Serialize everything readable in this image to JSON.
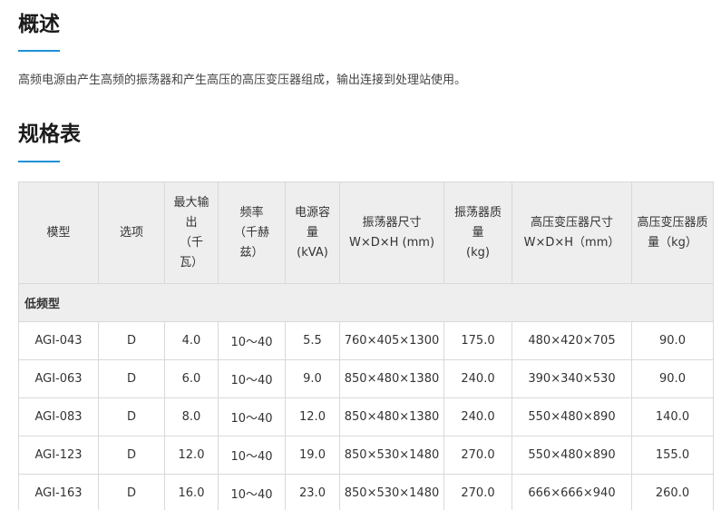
{
  "overview": {
    "heading": "概述",
    "text": "高频电源由产生高频的振荡器和产生高压的高压变压器组成，输出连接到处理站使用。"
  },
  "spec": {
    "heading": "规格表",
    "columns": [
      "模型",
      "选项",
      "最大输出（千瓦）",
      "频率（千赫兹）",
      "电源容量（kVA）",
      "振荡器尺寸 W×D×H (mm)",
      "振荡器质量（kg）",
      "高压变压器尺寸 W×D×H（mm）",
      "高压变压器质量（kg）"
    ],
    "header_lines": [
      [
        "模型"
      ],
      [
        "选项"
      ],
      [
        "最大输",
        "出",
        "（千",
        "瓦）"
      ],
      [
        "频率",
        "（千赫",
        "兹）"
      ],
      [
        "电源容",
        "量",
        "(kVA)"
      ],
      [
        "振荡器尺寸",
        "W×D×H (mm)"
      ],
      [
        "振荡器质",
        "量",
        "(kg)"
      ],
      [
        "高压变压器尺寸",
        "W×D×H（mm）"
      ],
      [
        "高压变压器质",
        "量（kg）"
      ]
    ],
    "group_label": "低频型",
    "rows": [
      [
        "AGI-043",
        "D",
        "4.0",
        "10～40",
        "5.5",
        "760×405×1300",
        "175.0",
        "480×420×705",
        "90.0"
      ],
      [
        "AGI-063",
        "D",
        "6.0",
        "10～40",
        "9.0",
        "850×480×1380",
        "240.0",
        "390×340×530",
        "90.0"
      ],
      [
        "AGI-083",
        "D",
        "8.0",
        "10～40",
        "12.0",
        "850×480×1380",
        "240.0",
        "550×480×890",
        "140.0"
      ],
      [
        "AGI-123",
        "D",
        "12.0",
        "10～40",
        "19.0",
        "850×530×1480",
        "270.0",
        "550×480×890",
        "155.0"
      ],
      [
        "AGI-163",
        "D",
        "16.0",
        "10～40",
        "23.0",
        "850×530×1480",
        "270.0",
        "666×666×940",
        "260.0"
      ]
    ]
  },
  "colors": {
    "accent": "#1e90d6",
    "header_bg": "#eeeeee",
    "border": "#d9d9d9"
  }
}
